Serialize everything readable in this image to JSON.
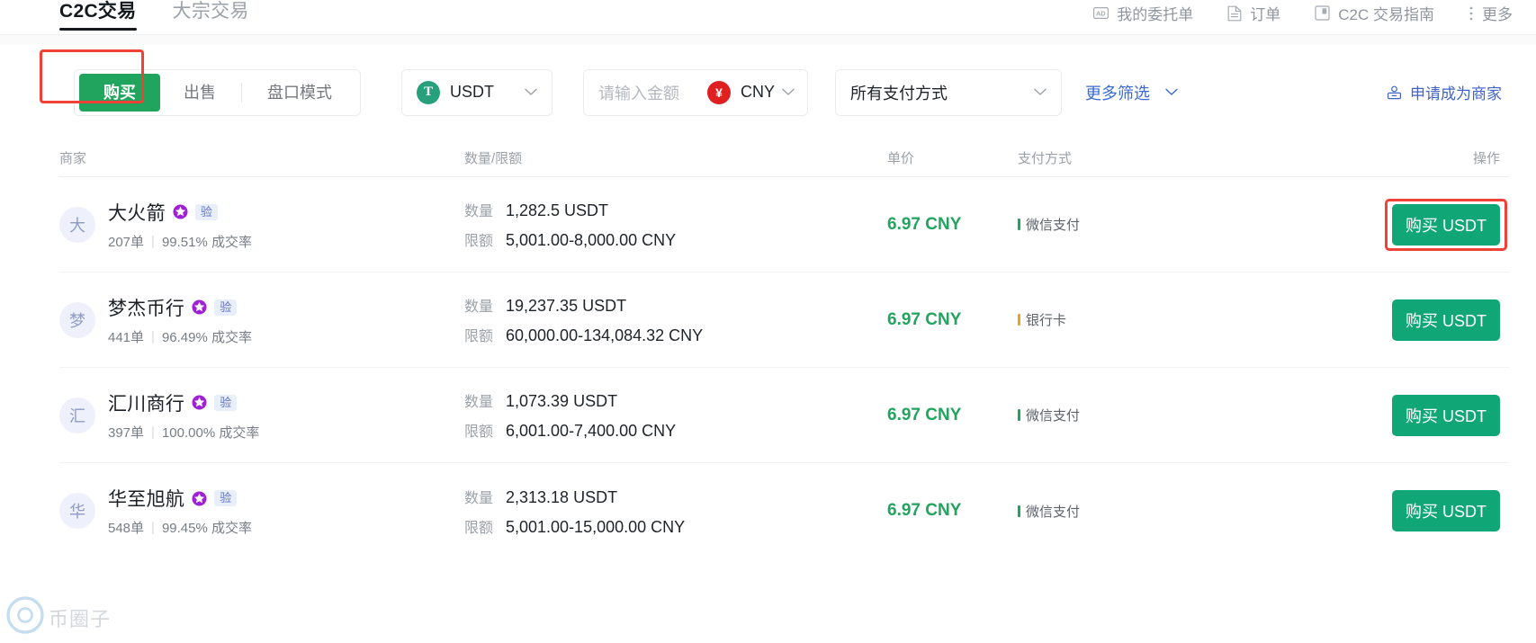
{
  "topnav": {
    "tabs": [
      {
        "label": "C2C交易",
        "active": true
      },
      {
        "label": "大宗交易",
        "active": false
      }
    ],
    "links": [
      {
        "label": "我的委托单",
        "icon": "ad-badge-icon"
      },
      {
        "label": "订单",
        "icon": "document-icon"
      },
      {
        "label": "C2C 交易指南",
        "icon": "book-icon"
      },
      {
        "label": "更多",
        "icon": "more-vertical-icon"
      }
    ]
  },
  "filters": {
    "side_tabs": [
      {
        "label": "购买",
        "active": true
      },
      {
        "label": "出售",
        "active": false
      },
      {
        "label": "盘口模式",
        "active": false
      }
    ],
    "coin": {
      "symbol": "USDT",
      "badge": "T",
      "badge_color": "#26a17b"
    },
    "amount": {
      "placeholder": "请输入金额",
      "value": ""
    },
    "fiat": {
      "symbol": "CNY",
      "badge": "¥",
      "badge_color": "#e02020"
    },
    "payment": {
      "label": "所有支付方式"
    },
    "more_filters": {
      "label": "更多筛选"
    },
    "apply_merchant": {
      "label": "申请成为商家",
      "color": "#3f63c9"
    }
  },
  "table": {
    "headers": {
      "merchant": "商家",
      "amount": "数量/限额",
      "price": "单价",
      "payment": "支付方式",
      "action": "操作"
    },
    "labels": {
      "quantity": "数量",
      "limit": "限额",
      "verified": "验",
      "orders_suffix": "单",
      "rate_suffix": "成交率",
      "separator": "|"
    },
    "rows": [
      {
        "avatar": "大",
        "name": "大火箭",
        "orders": "207单",
        "rate": "99.51% 成交率",
        "quantity": "1,282.5 USDT",
        "limit": "5,001.00-8,000.00 CNY",
        "price": "6.97 CNY",
        "payment": "微信支付",
        "payment_color": "#21a45d",
        "button": "购买 USDT",
        "highlighted": true
      },
      {
        "avatar": "梦",
        "name": "梦杰币行",
        "orders": "441单",
        "rate": "96.49% 成交率",
        "quantity": "19,237.35 USDT",
        "limit": "60,000.00-134,084.32 CNY",
        "price": "6.97 CNY",
        "payment": "银行卡",
        "payment_color": "#f0a020",
        "button": "购买 USDT",
        "highlighted": false
      },
      {
        "avatar": "汇",
        "name": "汇川商行",
        "orders": "397单",
        "rate": "100.00% 成交率",
        "quantity": "1,073.39 USDT",
        "limit": "6,001.00-7,400.00 CNY",
        "price": "6.97 CNY",
        "payment": "微信支付",
        "payment_color": "#21a45d",
        "button": "购买 USDT",
        "highlighted": false
      },
      {
        "avatar": "华",
        "name": "华至旭航",
        "orders": "548单",
        "rate": "99.45% 成交率",
        "quantity": "2,313.18 USDT",
        "limit": "5,001.00-15,000.00 CNY",
        "price": "6.97 CNY",
        "payment": "微信支付",
        "payment_color": "#21a45d",
        "button": "购买 USDT",
        "highlighted": false
      }
    ]
  },
  "watermark": {
    "text": "币圈子"
  },
  "accents": {
    "buy_green": "#21a45d",
    "button_green": "#11a675",
    "highlight_red": "#ef4136",
    "link_blue": "#3f63c9"
  }
}
